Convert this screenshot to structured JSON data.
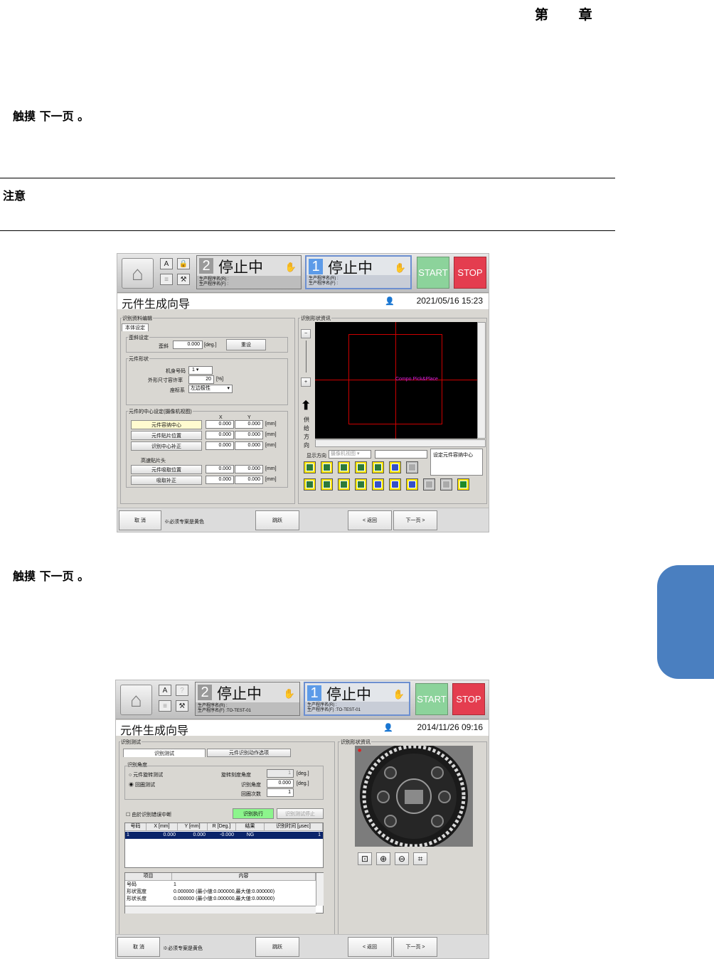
{
  "page": {
    "chapter": "第 章",
    "step1": "触摸 下一页 。",
    "note_label": "注意",
    "step2": "触摸 下一页 。"
  },
  "screen1": {
    "topbar": {
      "lane2_num": "2",
      "lane2_status": "停止中",
      "lane2_prog_r": "生产程序名(R) :",
      "lane2_prog_f": "生产程序名(F) :",
      "lane1_num": "1",
      "lane1_status": "停止中",
      "lane1_prog_r": "生产程序名(R) :",
      "lane1_prog_f": "生产程序名(F) :",
      "start": "START",
      "stop": "STOP"
    },
    "title": "元件生成向导",
    "datetime": "2021/05/16 15:23",
    "edit_group": "识别资料编辑",
    "tab_body": "本体设定",
    "skew_group": "歪斜设定",
    "skew_label": "歪斜",
    "skew_value": "0.000",
    "skew_unit": "[deg.]",
    "reset": "重设",
    "shape_group": "元件形状",
    "nozzle_label": "机身号码",
    "nozzle_value": "1",
    "tolerance_label": "外形尺寸容许率",
    "tolerance_value": "20",
    "tolerance_unit": "[%]",
    "coord_label": "座标系",
    "coord_value": "左边极性",
    "center_group": "元件的中心设定(摄像机视图)",
    "col_x": "X",
    "col_y": "Y",
    "rows": [
      {
        "label": "元件容纳中心",
        "x": "0.000",
        "y": "0.000",
        "unit": "[mm]",
        "yellow": true
      },
      {
        "label": "元件贴片位置",
        "x": "0.000",
        "y": "0.000",
        "unit": "[mm]",
        "yellow": false
      },
      {
        "label": "识别中心补正",
        "x": "0.000",
        "y": "0.000",
        "unit": "[mm]",
        "yellow": false
      }
    ],
    "head_label": "高速贴片头",
    "rows2": [
      {
        "label": "元件吸取位置",
        "x": "0.000",
        "y": "0.000",
        "unit": "[mm]"
      },
      {
        "label": "吸取补正",
        "x": "0.000",
        "y": "0.000",
        "unit": "[mm]"
      }
    ],
    "shape_info": "识别形状资讯",
    "feed_dir": "供给方向",
    "canvas_label": "Compo.Pick&Place",
    "display_dir": "显示方向",
    "display_value": "摄像机视图",
    "hint": "设定元件容纳中心",
    "bottom": {
      "cancel": "取 消",
      "required": "※必须专案是黄色",
      "skip": "跳跃",
      "back": "< 返回",
      "next": "下一页 >"
    }
  },
  "screen2": {
    "topbar": {
      "lane2_num": "2",
      "lane2_status": "停止中",
      "lane2_prog_r": "生产程序名(R) :",
      "lane2_prog_f": "生产程序名(F) :TO-TEST-01",
      "lane1_num": "1",
      "lane1_status": "停止中",
      "lane1_prog_r": "生产程序名(R) :",
      "lane1_prog_f": "生产程序名(F) :TO-TEST-01",
      "start": "START",
      "stop": "STOP"
    },
    "title": "元件生成向导",
    "datetime": "2014/11/26 09:16",
    "test_group": "识别测试",
    "tab_test": "识别测试",
    "tab_options": "元件识别动作选项",
    "angle_group": "识别角度",
    "radio_rotate": "元件旋转测试",
    "radio_cycle": "回圈测试",
    "rotate_step_label": "旋转刻度角度",
    "rotate_step_value": "1",
    "angle_label": "识别角度",
    "angle_value": "0.000",
    "deg_unit": "[deg.]",
    "cycles_label": "回圈次数",
    "cycles_value": "1",
    "stop_on_error": "由於识别错误中断",
    "run": "识别执行",
    "stop_test": "识别测试停止",
    "table_headers": [
      "号码",
      "X [mm]",
      "Y [mm]",
      "R [Deg.]",
      "结果",
      "识别时间 [μsec]"
    ],
    "table_rows": [
      [
        "1",
        "0.000",
        "0.000",
        "-0.000",
        "NG",
        "1"
      ]
    ],
    "detail_headers": [
      "项目",
      "内容"
    ],
    "detail_rows": [
      [
        "号码",
        "1"
      ],
      [
        "形状宽度",
        "0.000000 (最小値:0.000000,最大値:0.000000)"
      ],
      [
        "形状长度",
        "0.000000 (最小値:0.000000,最大値:0.000000)"
      ]
    ],
    "shape_info": "识别形状资讯",
    "bottom": {
      "cancel": "取 消",
      "required": "※必须专案是黄色",
      "skip": "跳跃",
      "back": "< 返回",
      "next": "下一页 >"
    }
  }
}
